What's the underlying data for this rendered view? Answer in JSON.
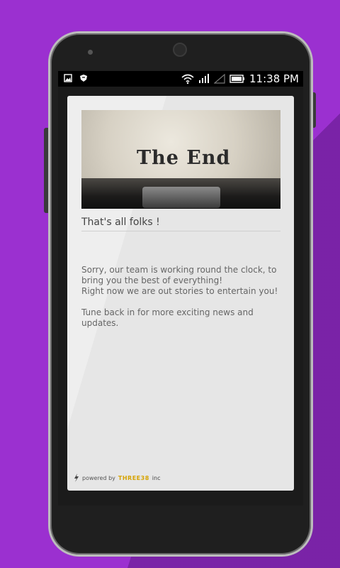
{
  "status_bar": {
    "time": "11:38 PM"
  },
  "card": {
    "hero_text": "The End",
    "title": "That's all folks !",
    "body": {
      "line1": "Sorry, our team is working round the clock, to bring you the best of everything!",
      "line2": "Right now we are out stories to entertain you!",
      "line3": "Tune back in for more exciting news and updates."
    },
    "footer": {
      "powered_by": "powered by",
      "brand": "THREE38",
      "suffix": "inc"
    }
  },
  "colors": {
    "background": "#9b30d0",
    "brand": "#d6a300"
  }
}
